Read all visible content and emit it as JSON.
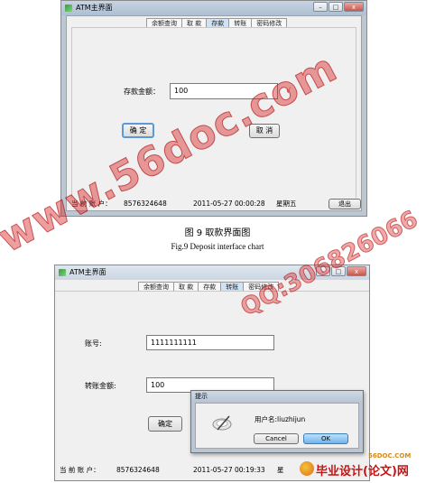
{
  "deposit_window": {
    "title": "ATM主界面",
    "window_buttons": [
      "–",
      "□",
      "x"
    ],
    "tabs": [
      {
        "label": "余额查询",
        "active": false
      },
      {
        "label": "取 款",
        "active": false
      },
      {
        "label": "存款",
        "active": true
      },
      {
        "label": "转账",
        "active": false
      },
      {
        "label": "密码修改",
        "active": false
      }
    ],
    "amount_label": "存款金额：",
    "amount_value": "100",
    "check_mark": "√",
    "confirm_label": "确 定",
    "cancel_label": "取 消",
    "status": {
      "account_label": "当 前 账 户：",
      "account_number": "8576324648",
      "datetime": "2011-05-27 00:00:28",
      "weekday": "星期五",
      "exit_label": "退出"
    }
  },
  "caption_cn": "图 9   取款界面图",
  "caption_en": "Fig.9    Deposit interface chart",
  "transfer_window": {
    "title": "ATM主界面",
    "window_buttons": [
      "–",
      "□",
      "x"
    ],
    "tabs": [
      {
        "label": "余额查询",
        "active": false
      },
      {
        "label": "取 款",
        "active": false
      },
      {
        "label": "存款",
        "active": false
      },
      {
        "label": "转账",
        "active": true
      },
      {
        "label": "密码修改",
        "active": false
      }
    ],
    "account_label": "账号:",
    "account_value": "1111111111",
    "amount_label": "转账金额:",
    "amount_value": "100",
    "confirm_label": "确定",
    "status": {
      "account_label": "当 前 账 户：",
      "account_number": "8576324648",
      "datetime": "2011-05-27 00:19:33",
      "weekday": "星"
    }
  },
  "dialog": {
    "title": "提示",
    "message": "用户名:liuzhijun",
    "cancel_label": "Cancel",
    "ok_label": "OK"
  },
  "watermarks": {
    "main": "www.56doc.com",
    "qq": "QQ:306826066"
  },
  "footer": {
    "site": "56DOC.COM",
    "brand": "毕业设计(论文)网"
  },
  "colors": {
    "window_frame": "#bcc7d4",
    "check_red": "#d00000",
    "watermark_red": "#d72828",
    "active_tab": "#cfe3f7",
    "focus_blue": "#5a9ad6"
  }
}
